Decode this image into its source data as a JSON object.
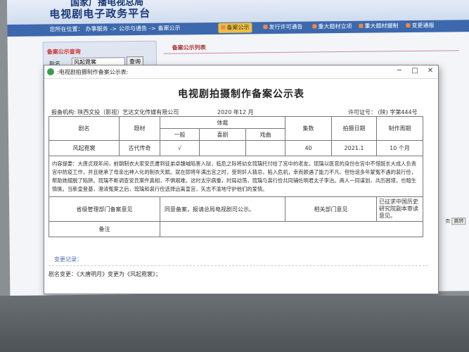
{
  "site": {
    "title_top": "国家广播电视总局",
    "title": "电视剧电子政务平台",
    "breadcrumb": [
      "您所在位置：",
      "办事服务",
      "->",
      "公示与通告",
      "->",
      "备案公示"
    ],
    "nav_tabs": [
      {
        "label": "备案公示",
        "active": true
      },
      {
        "label": "发行许可通告",
        "active": false
      },
      {
        "label": "重大题材立项",
        "active": false
      },
      {
        "label": "重大题材摄制",
        "active": false
      },
      {
        "label": "变更通报",
        "active": false
      }
    ]
  },
  "left_panel": {
    "title": "备案公示查询",
    "label": "剧名",
    "search_value": "风起霓裳",
    "search_button": "查询"
  },
  "right_panel": {
    "title": "备案公示列表",
    "page_suffix": "页",
    "jump_button": "跳转"
  },
  "window": {
    "title": ":电视剧拍摄制作备案公示表:",
    "minimize": "─",
    "maximize": "□",
    "close": "✕"
  },
  "doc": {
    "title": "电视剧拍摄制作备案公示表",
    "org_label": "报备机构:",
    "org_value": "陕西文投（影视）艺达文化传媒有限公司",
    "date": "2020 年12 月",
    "license_label": "许可证号：",
    "license_value": "(陕) 字第444号",
    "headers": {
      "name": "剧名",
      "subject": "题材",
      "genre": "体裁",
      "genre_sub": [
        "一般",
        "喜剧",
        "戏曲"
      ],
      "episodes": "集数",
      "shoot_date": "拍摄日期",
      "period": "制作周期"
    },
    "row": {
      "name": "风起霓裳",
      "subject": "古代传奇",
      "general": "√",
      "comedy": "",
      "opera": "",
      "episodes": "40",
      "shoot_date": "2021.1",
      "period": "10 个月"
    },
    "content": "内容提要：大唐贞观年间，前朝制衣大家安氏遭到徒弟卓魏喊陷害入狱，临危之际将幼女琉璃托付给了宫中的老友。琉璃以医官的身份在宫中不惜既长大成人负责宫中防疫工作，并且继承了母亲出神入化的制衣天赋。就在即将年满出宫之时，受到奸人猜忌，陷入危机，幸而顾遇了能力不凡、但怡谊多年蒙冤不遇的裴行俭，帮助她摆脱了陷阱。琉璃不断调查安氏案件真相，不惧艰难。这时太宗病重，时局动荡，琉璃与裴行俭共同辅佐明君太子李治。两人一同谋划，共历困境，也暗生情愫。当新皇登基，澄清冤案之后，琉璃和裴行俭选择远离皇宫，矢志不渝地守护他们的爱情。",
    "opinion_provincial": "省级管理部门备案意见",
    "opinion_registered": "同意备案，报请总局电视剧司公示。",
    "opinion_related": "相关部门意见",
    "opinion_related_value": "已征求中国历史研究院副本审读意见。",
    "remark": "备注",
    "change_record_label": "变更记录：",
    "rename": "剧名变更：《大唐明月》变更为《风起霓裳》；"
  }
}
